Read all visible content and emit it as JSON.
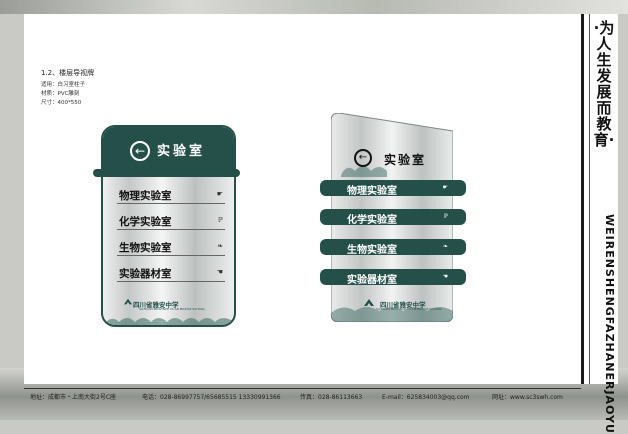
{
  "spec": {
    "title": "1.2、楼层导视牌",
    "lines": [
      "适用：白习室柱子",
      "材质：PVC雕刻",
      "尺寸：400*550"
    ]
  },
  "sign_left": {
    "header": "实验室",
    "items": [
      {
        "label": "物理实验室",
        "icon": "magnet-icon",
        "glyph": "☛"
      },
      {
        "label": "化学实验室",
        "icon": "flask-icon",
        "glyph": "ℙ"
      },
      {
        "label": "生物实验室",
        "icon": "leaf-icon",
        "glyph": "❧"
      },
      {
        "label": "实验器材室",
        "icon": "tools-icon",
        "glyph": "☚"
      }
    ],
    "school": "四川省雅安中学",
    "school_en": "SICHUAN PROVINCE YA AN MIDDLE SCHOOL"
  },
  "sign_right": {
    "header": "实验室",
    "items": [
      {
        "label": "物理实验室",
        "icon": "magnet-icon",
        "glyph": "☛"
      },
      {
        "label": "化学实验室",
        "icon": "flask-icon",
        "glyph": "ℙ"
      },
      {
        "label": "生物实验室",
        "icon": "leaf-icon",
        "glyph": "❧"
      },
      {
        "label": "实验器材室",
        "icon": "tools-icon",
        "glyph": "☚"
      }
    ],
    "school": "四川省雅安中学",
    "school_en": "SICHUAN PROVINCE YA AN MIDDLE SCHOOL"
  },
  "spine": {
    "chinese": "·为人生发展而教育·",
    "roman": "WEIRENSHENGFAZHANERJAOYU"
  },
  "footer": {
    "address": "地址：成都市・上南大街2号C座",
    "phone": "电话：028-86997757/65685515  13330991366",
    "fax": "传真：028-86113663",
    "email": "E-mail：625834003@qq.com",
    "website": "网址：www.sc3swh.com"
  },
  "colors": {
    "brand": "#25504a",
    "background": "#ffffff"
  }
}
